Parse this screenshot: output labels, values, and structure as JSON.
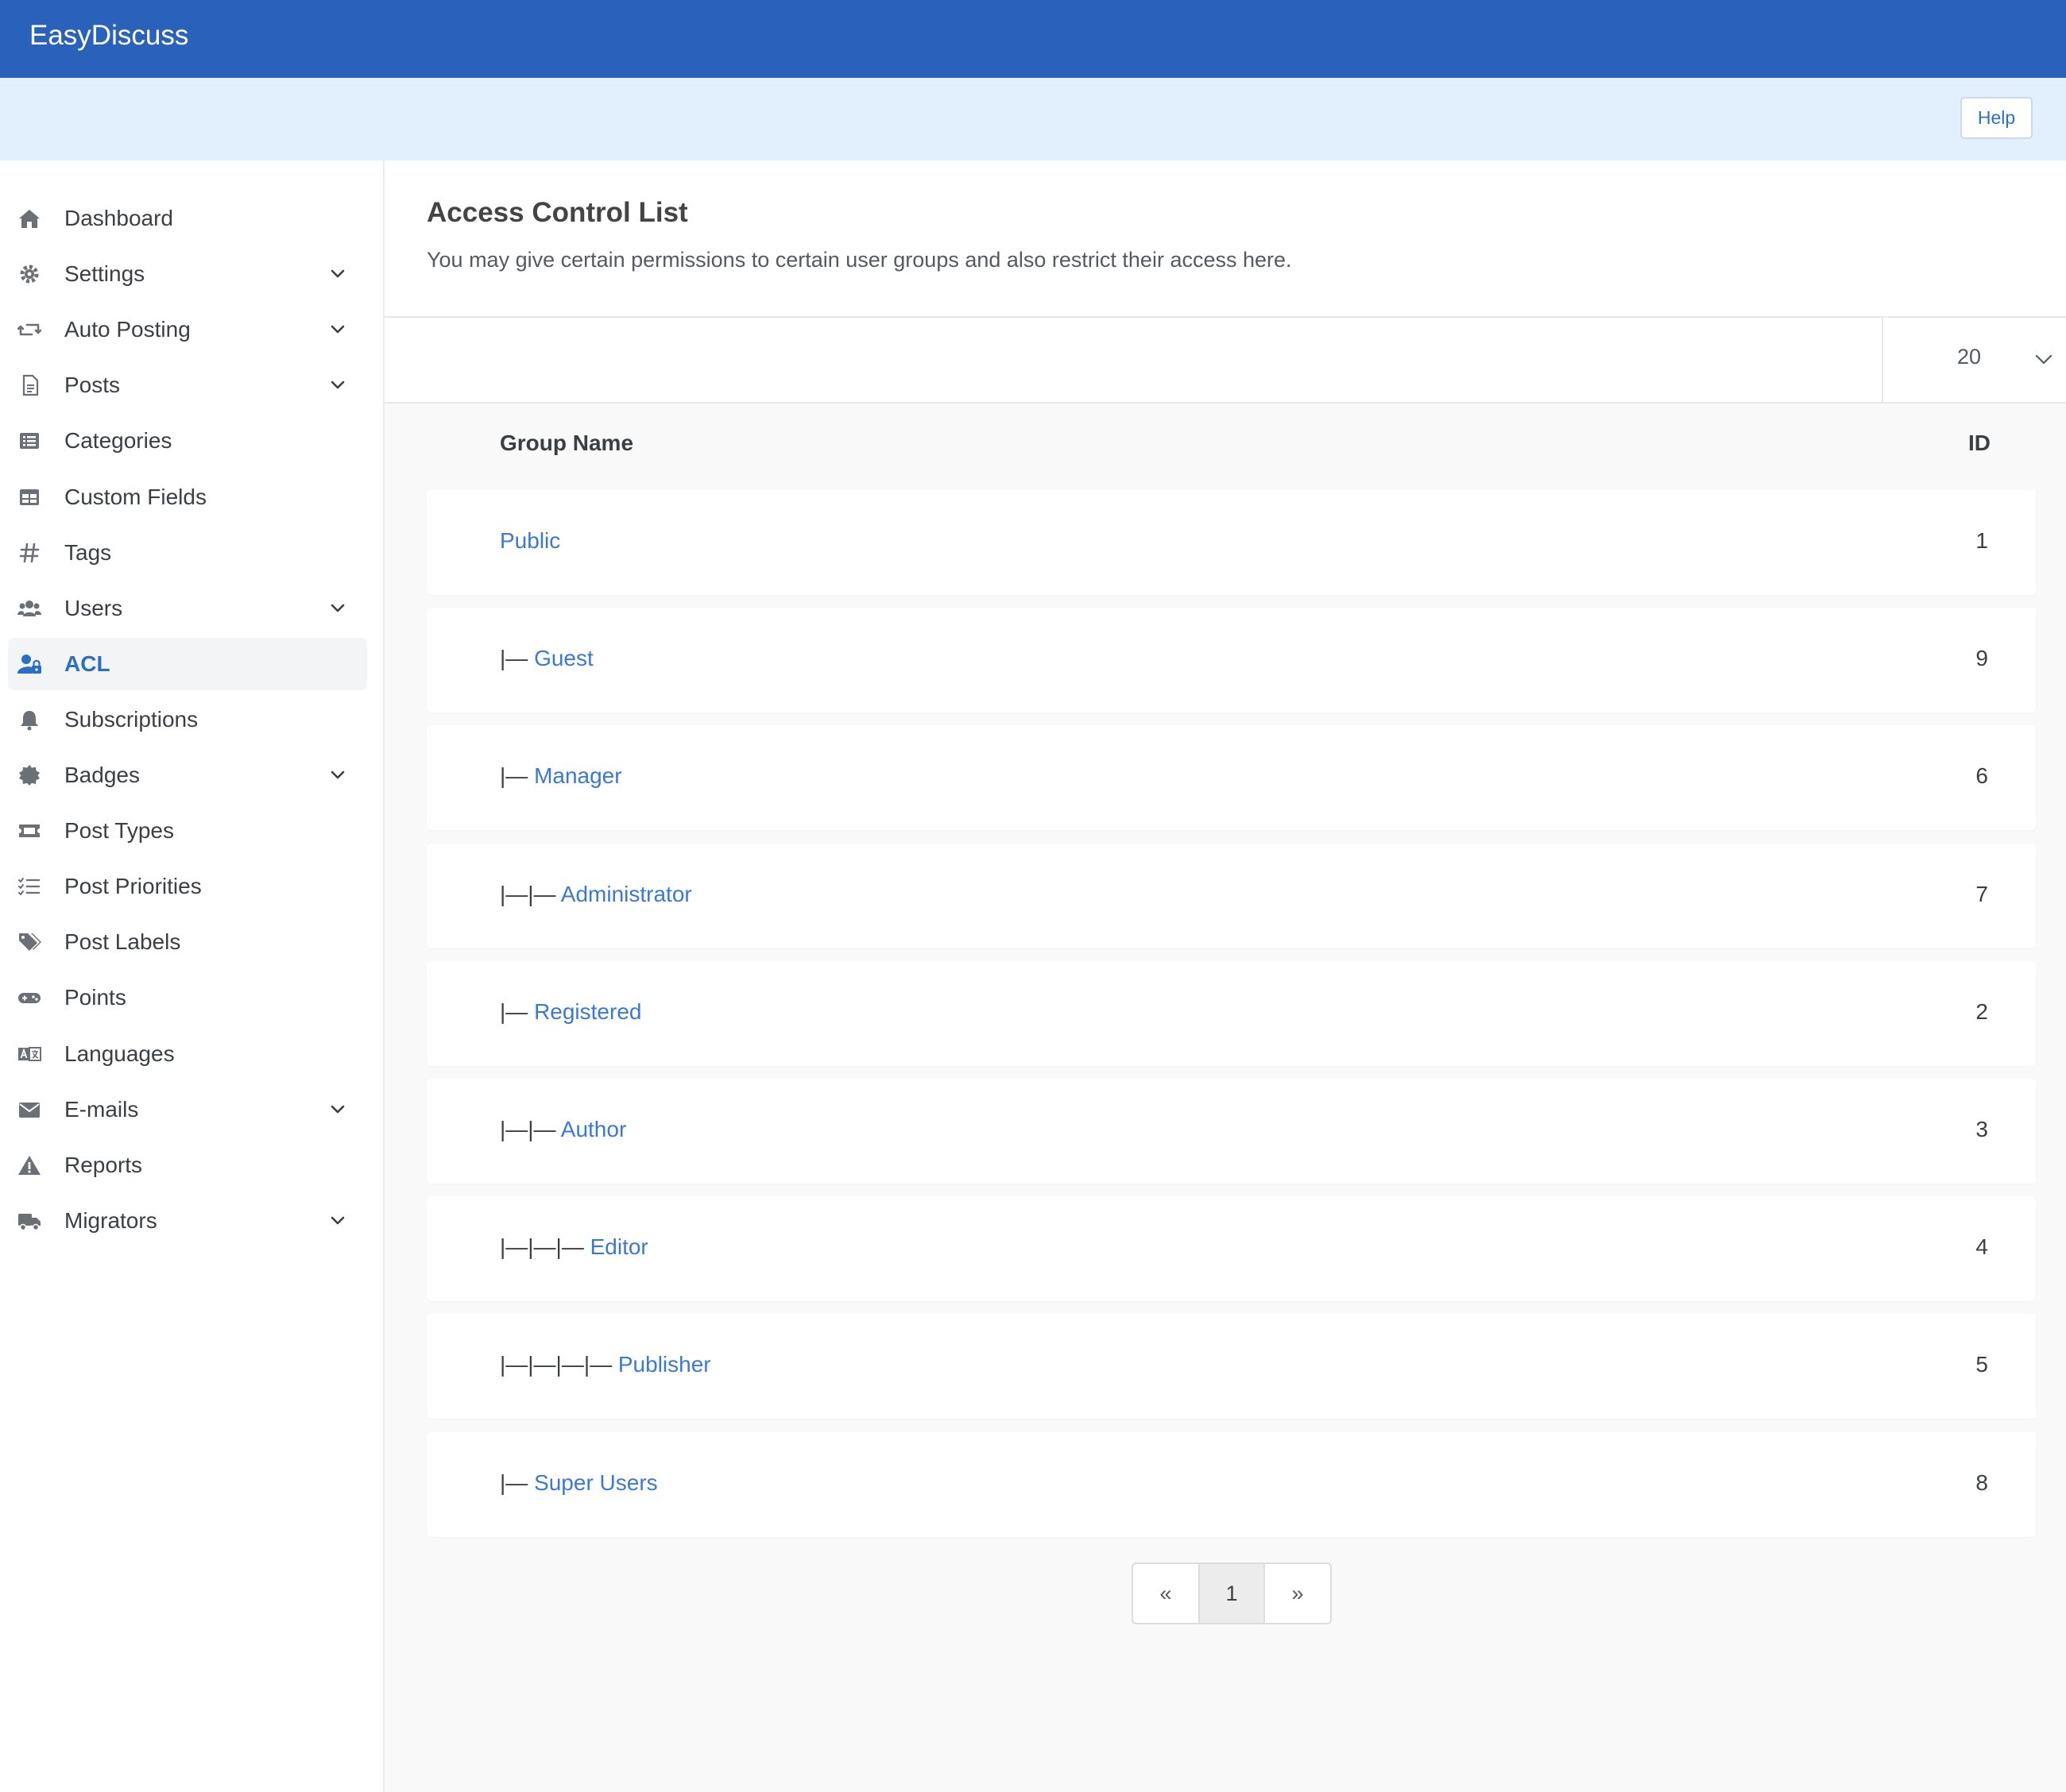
{
  "app": {
    "brand": "EasyDiscuss"
  },
  "subheader": {
    "help_label": "Help"
  },
  "sidebar": {
    "items": [
      {
        "key": "dashboard",
        "label": "Dashboard",
        "icon": "home-icon",
        "has_submenu": false,
        "active": false
      },
      {
        "key": "settings",
        "label": "Settings",
        "icon": "gear-icon",
        "has_submenu": true,
        "active": false
      },
      {
        "key": "auto-posting",
        "label": "Auto Posting",
        "icon": "retweet-icon",
        "has_submenu": true,
        "active": false
      },
      {
        "key": "posts",
        "label": "Posts",
        "icon": "document-icon",
        "has_submenu": true,
        "active": false
      },
      {
        "key": "categories",
        "label": "Categories",
        "icon": "list-alt-icon",
        "has_submenu": false,
        "active": false
      },
      {
        "key": "custom-fields",
        "label": "Custom Fields",
        "icon": "table-icon",
        "has_submenu": false,
        "active": false
      },
      {
        "key": "tags",
        "label": "Tags",
        "icon": "hashtag-icon",
        "has_submenu": false,
        "active": false
      },
      {
        "key": "users",
        "label": "Users",
        "icon": "users-icon",
        "has_submenu": true,
        "active": false
      },
      {
        "key": "acl",
        "label": "ACL",
        "icon": "user-lock-icon",
        "has_submenu": false,
        "active": true
      },
      {
        "key": "subscriptions",
        "label": "Subscriptions",
        "icon": "bell-icon",
        "has_submenu": false,
        "active": false
      },
      {
        "key": "badges",
        "label": "Badges",
        "icon": "certificate-icon",
        "has_submenu": true,
        "active": false
      },
      {
        "key": "post-types",
        "label": "Post Types",
        "icon": "ticket-icon",
        "has_submenu": false,
        "active": false
      },
      {
        "key": "post-priorities",
        "label": "Post Priorities",
        "icon": "tasks-icon",
        "has_submenu": false,
        "active": false
      },
      {
        "key": "post-labels",
        "label": "Post Labels",
        "icon": "tags-icon",
        "has_submenu": false,
        "active": false
      },
      {
        "key": "points",
        "label": "Points",
        "icon": "gamepad-icon",
        "has_submenu": false,
        "active": false
      },
      {
        "key": "languages",
        "label": "Languages",
        "icon": "language-icon",
        "has_submenu": false,
        "active": false
      },
      {
        "key": "e-mails",
        "label": "E-mails",
        "icon": "envelope-icon",
        "has_submenu": true,
        "active": false
      },
      {
        "key": "reports",
        "label": "Reports",
        "icon": "warning-icon",
        "has_submenu": false,
        "active": false
      },
      {
        "key": "migrators",
        "label": "Migrators",
        "icon": "truck-icon",
        "has_submenu": true,
        "active": false
      }
    ]
  },
  "page": {
    "title": "Access Control List",
    "description": "You may give certain permissions to certain user groups and also restrict their access here."
  },
  "filter": {
    "limit_value": "20"
  },
  "table": {
    "columns": {
      "name": "Group Name",
      "id": "ID"
    },
    "rows": [
      {
        "prefix": "",
        "name": "Public",
        "id": "1"
      },
      {
        "prefix": "|— ",
        "name": "Guest",
        "id": "9"
      },
      {
        "prefix": "|— ",
        "name": "Manager",
        "id": "6"
      },
      {
        "prefix": "|—|— ",
        "name": "Administrator",
        "id": "7"
      },
      {
        "prefix": "|— ",
        "name": "Registered",
        "id": "2"
      },
      {
        "prefix": "|—|— ",
        "name": "Author",
        "id": "3"
      },
      {
        "prefix": "|—|—|— ",
        "name": "Editor",
        "id": "4"
      },
      {
        "prefix": "|—|—|—|— ",
        "name": "Publisher",
        "id": "5"
      },
      {
        "prefix": "|— ",
        "name": "Super Users",
        "id": "8"
      }
    ]
  },
  "pagination": {
    "prev": "«",
    "current": "1",
    "next": "»"
  },
  "colors": {
    "header_bg": "#2961bb",
    "subheader_bg": "#e2effd",
    "link": "#3a78d6",
    "active_accent": "#2a6fc4"
  }
}
